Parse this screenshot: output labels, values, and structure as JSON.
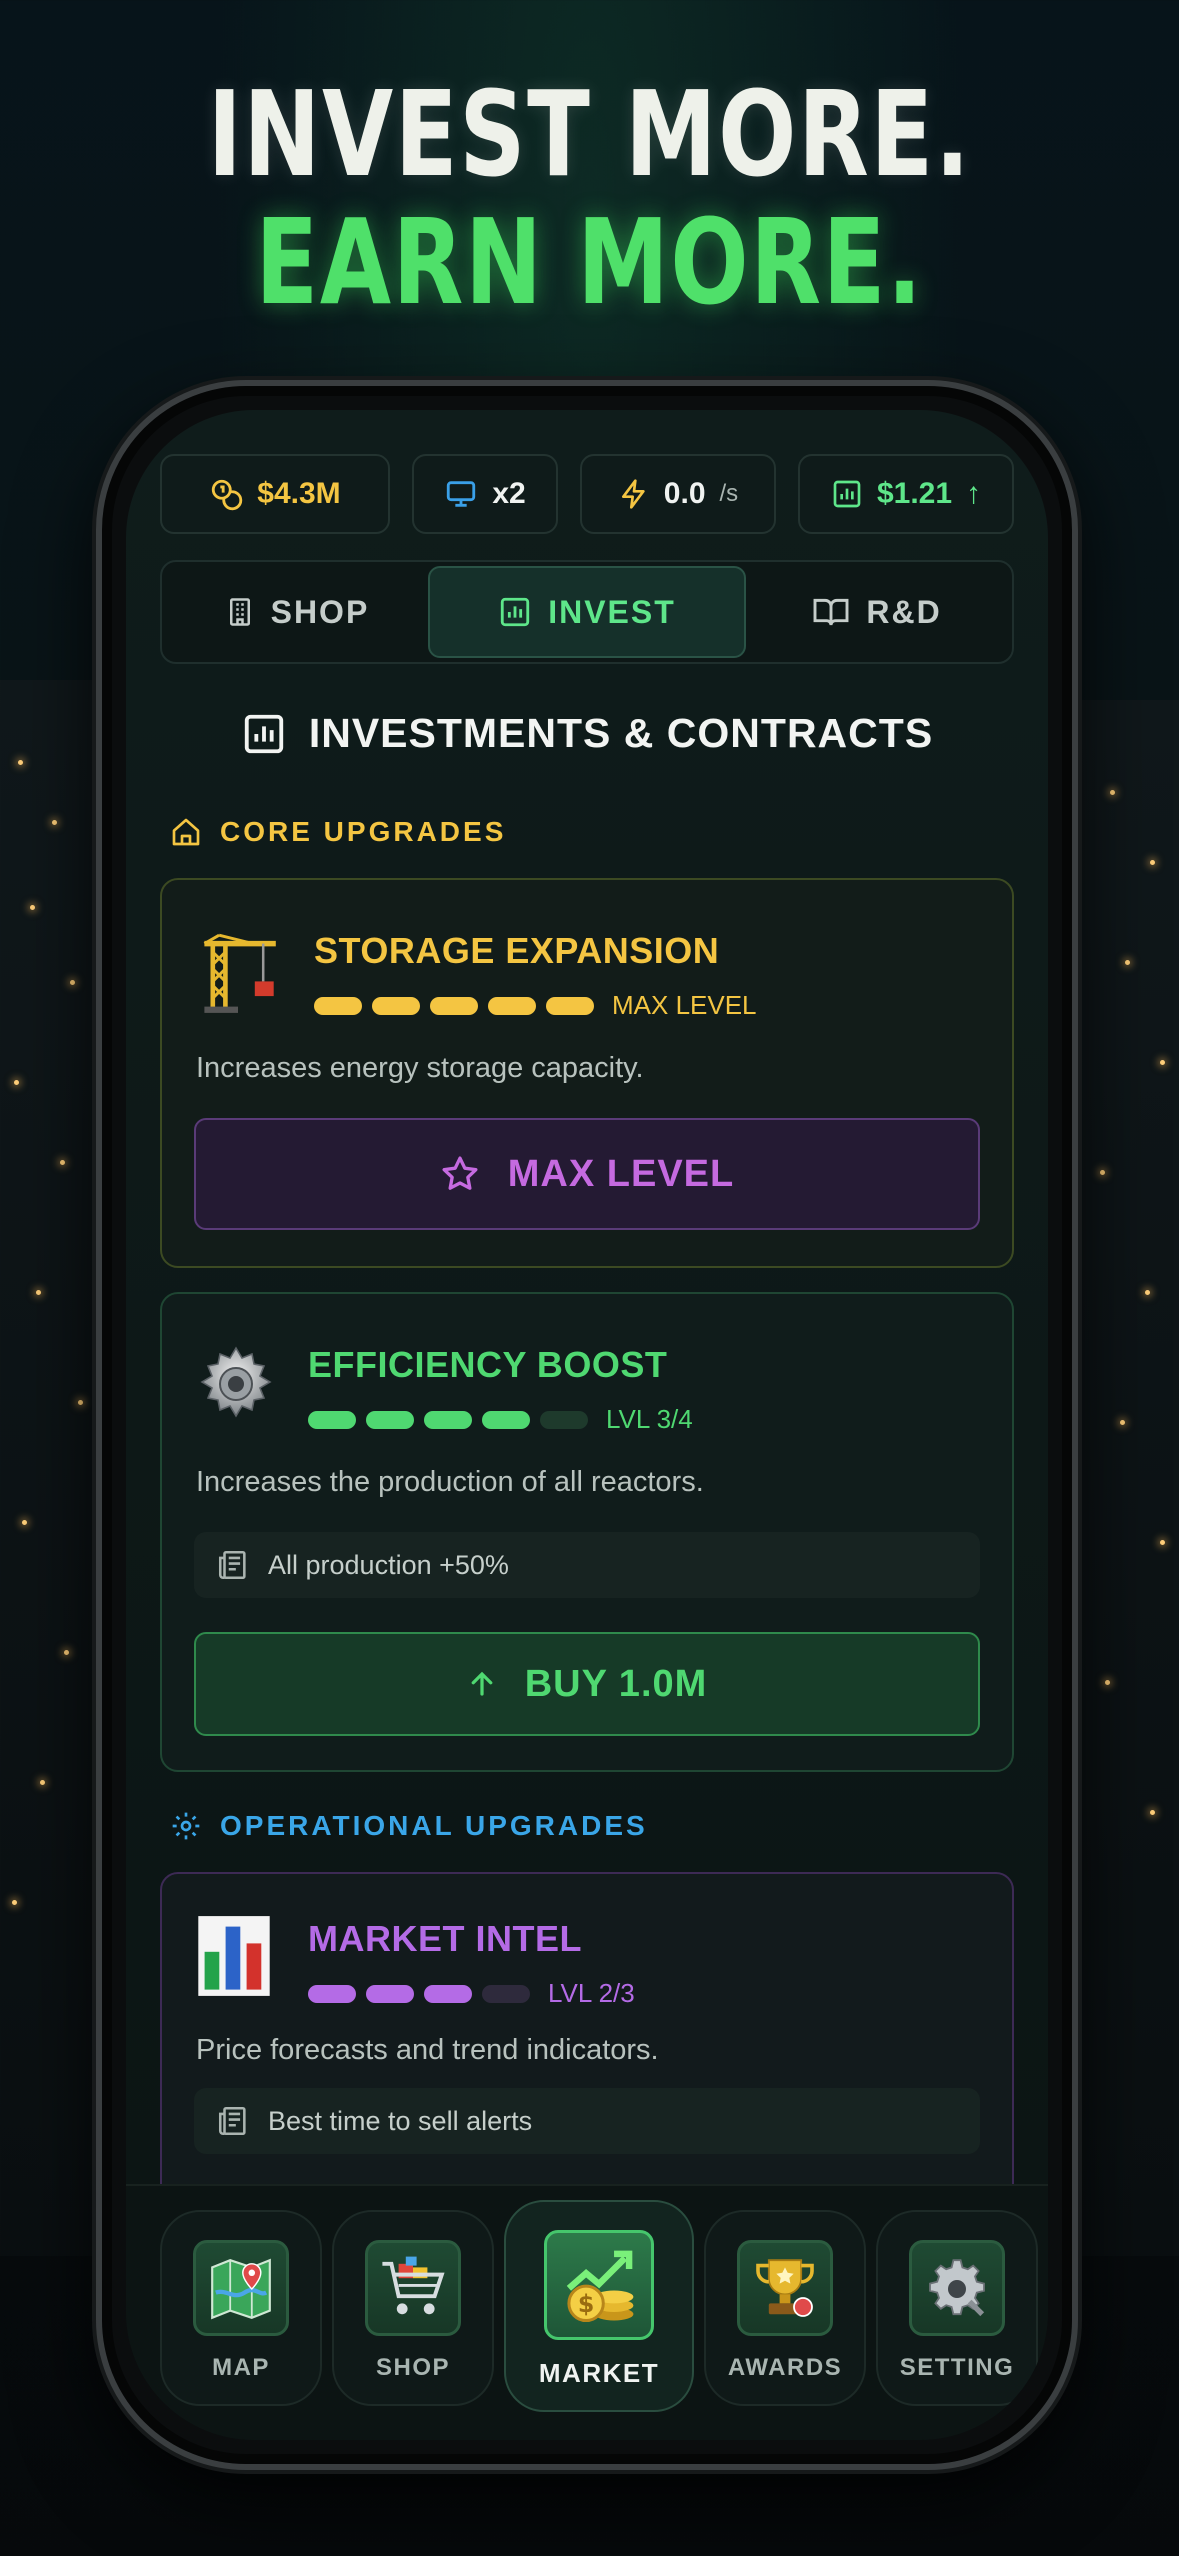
{
  "headline": {
    "line1": "INVEST MORE.",
    "line2": "EARN MORE."
  },
  "stats": [
    {
      "icon": "coins-icon",
      "value": "$4.3M",
      "color": "#f4c542"
    },
    {
      "icon": "monitor-icon",
      "value": "x2",
      "color": "#3aa0e8"
    },
    {
      "icon": "lightning-icon",
      "value": "0.0",
      "unit": "/s",
      "color": "#f4c542"
    },
    {
      "icon": "price-chart-icon",
      "value": "$1.21",
      "trend": "↑",
      "color": "#5ee68a"
    }
  ],
  "tabs": [
    {
      "label": "SHOP",
      "icon": "building-icon",
      "active": false
    },
    {
      "label": "INVEST",
      "icon": "chart-icon",
      "active": true
    },
    {
      "label": "R&D",
      "icon": "book-icon",
      "active": false
    }
  ],
  "section_title": "INVESTMENTS & CONTRACTS",
  "core_header": {
    "label": "CORE UPGRADES",
    "color": "#f4c542"
  },
  "operational_header": {
    "label": "OPERATIONAL UPGRADES",
    "color": "#3aa6e8"
  },
  "cards": {
    "storage": {
      "title": "STORAGE EXPANSION",
      "level_text": "MAX LEVEL",
      "level": 5,
      "max_level": 5,
      "description": "Increases energy storage capacity.",
      "button": "MAX LEVEL",
      "color": "#f4c542",
      "button_color": "#c56ae0"
    },
    "efficiency": {
      "title": "EFFICIENCY BOOST",
      "level_text": "LVL 3/4",
      "level": 3,
      "max_level": 4,
      "description": "Increases the production of all reactors.",
      "perk": "All production +50%",
      "button": "BUY 1.0M",
      "color": "#4fd871"
    },
    "market": {
      "title": "MARKET INTEL",
      "level_text": "LVL 2/3",
      "level": 2,
      "max_level": 3,
      "description": "Price forecasts and trend indicators.",
      "perk": "Best time to sell alerts",
      "color": "#b46be6"
    }
  },
  "bottom_nav": [
    {
      "label": "MAP",
      "icon": "map-icon",
      "active": false
    },
    {
      "label": "SHOP",
      "icon": "cart-icon",
      "active": false
    },
    {
      "label": "MARKET",
      "icon": "market-coins-icon",
      "active": true
    },
    {
      "label": "AWARDS",
      "icon": "trophy-icon",
      "active": false
    },
    {
      "label": "SETTING",
      "icon": "settings-gear-icon",
      "active": false
    }
  ]
}
